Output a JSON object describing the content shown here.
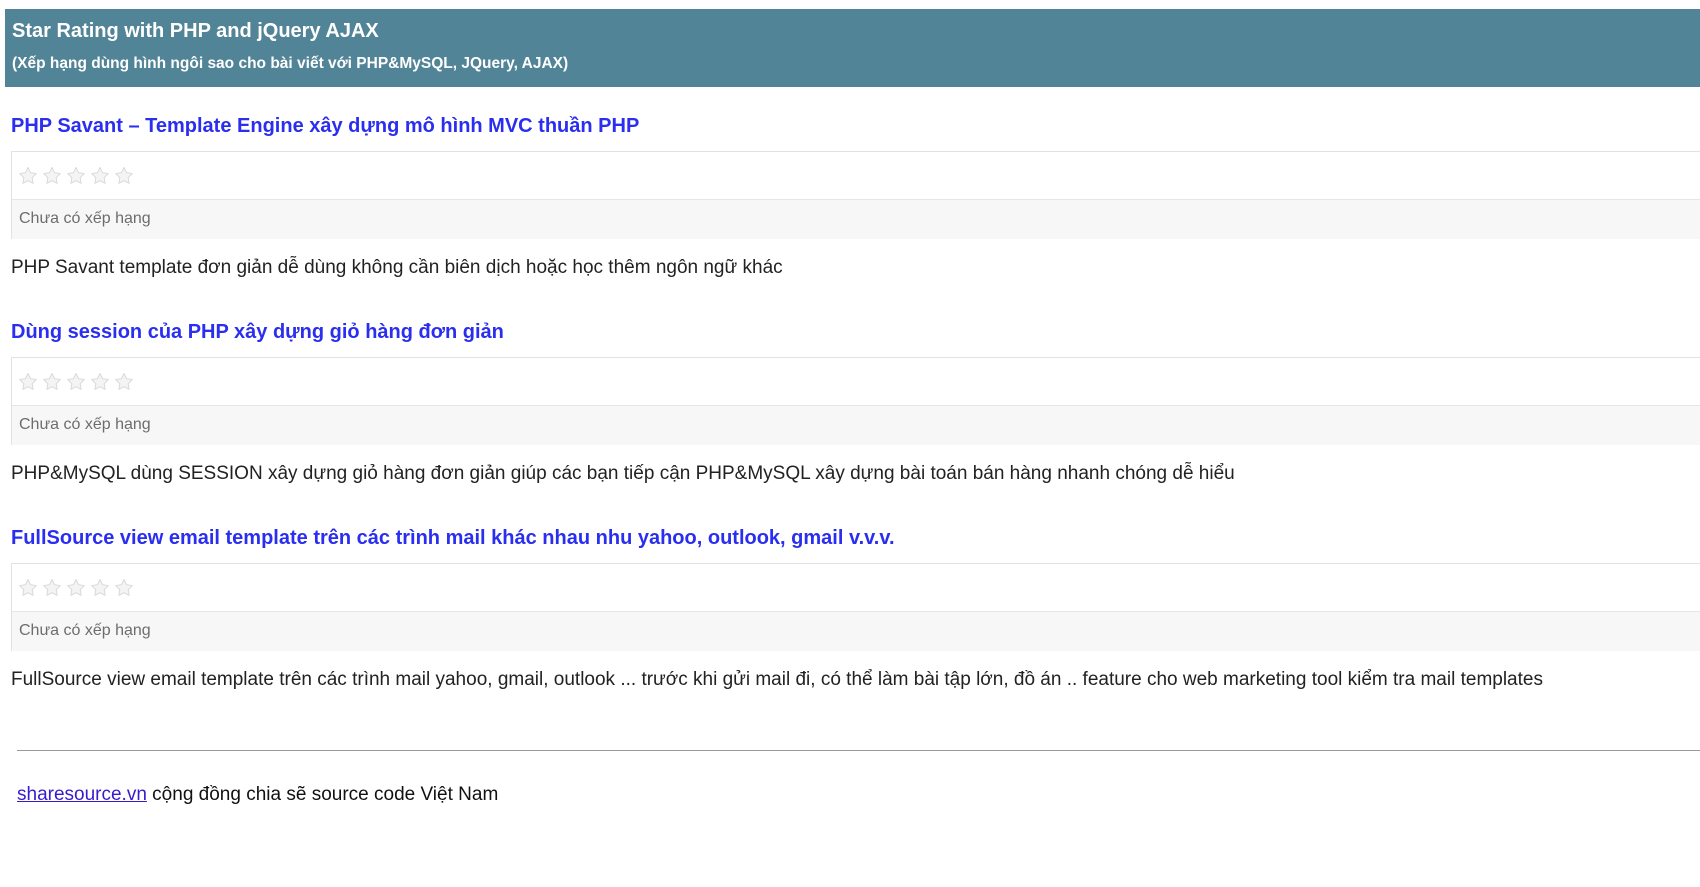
{
  "header": {
    "title": "Star Rating with PHP and jQuery AJAX",
    "subtitle": "(Xếp hạng dùng hình ngôi sao cho bài viết với PHP&MySQL, JQuery, AJAX)",
    "background_color": "#528497"
  },
  "articles": [
    {
      "title": "PHP Savant – Template Engine xây dựng mô hình MVC thuần PHP",
      "rating": {
        "stars_total": 5,
        "stars_filled": 0,
        "status": "Chưa có xếp hạng"
      },
      "description": "PHP Savant template đơn giản dễ dùng không cần biên dịch hoặc học thêm ngôn ngữ khác"
    },
    {
      "title": "Dùng session của PHP xây dựng giỏ hàng đơn giản",
      "rating": {
        "stars_total": 5,
        "stars_filled": 0,
        "status": "Chưa có xếp hạng"
      },
      "description": "PHP&MySQL dùng SESSION xây dựng giỏ hàng đơn giản giúp các bạn tiếp cận PHP&MySQL xây dựng bài toán bán hàng nhanh chóng dễ hiểu"
    },
    {
      "title": "FullSource view email template trên các trình mail khác nhau nhu yahoo, outlook, gmail v.v.v.",
      "rating": {
        "stars_total": 5,
        "stars_filled": 0,
        "status": "Chưa có xếp hạng"
      },
      "description": "FullSource view email template trên các trình mail yahoo, gmail, outlook ... trước khi gửi mail đi, có thể làm bài tập lớn, đồ án .. feature cho web marketing tool kiểm tra mail templates"
    }
  ],
  "footer": {
    "link_text": "sharesource.vn",
    "text": " cộng đồng chia sẽ source code Việt Nam"
  },
  "colors": {
    "title_link": "#2a2ef0",
    "star_empty": "#d9d9d9"
  },
  "icons": {
    "star": "star-icon"
  }
}
